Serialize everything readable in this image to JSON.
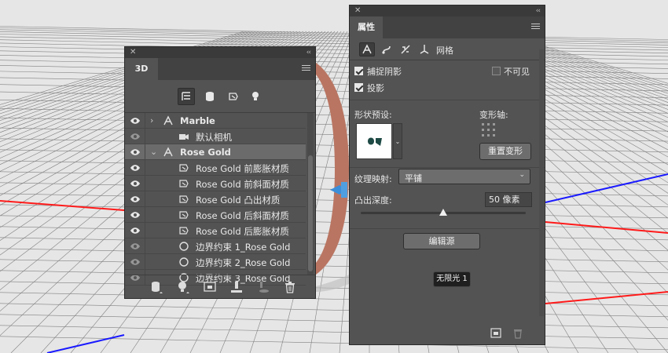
{
  "panel_3d": {
    "tab": "3D",
    "toolbar": [
      "scene-filter-icon",
      "mesh-filter-icon",
      "material-filter-icon",
      "light-filter-icon"
    ],
    "layers": [
      {
        "label": "Marble",
        "visible": true,
        "icon": "mesh-icon",
        "expandable": true,
        "expanded": false,
        "bold": true
      },
      {
        "label": "默认相机",
        "visible": false,
        "icon": "camera-icon"
      },
      {
        "label": "Rose Gold",
        "visible": true,
        "icon": "mesh-icon",
        "expandable": true,
        "expanded": true,
        "bold": true,
        "selected": true
      },
      {
        "label": "Rose Gold 前膨胀材质",
        "visible": true,
        "icon": "material-icon"
      },
      {
        "label": "Rose Gold 前斜面材质",
        "visible": true,
        "icon": "material-icon"
      },
      {
        "label": "Rose Gold 凸出材质",
        "visible": true,
        "icon": "material-icon"
      },
      {
        "label": "Rose Gold 后斜面材质",
        "visible": true,
        "icon": "material-icon"
      },
      {
        "label": "Rose Gold 后膨胀材质",
        "visible": true,
        "icon": "material-icon"
      },
      {
        "label": "边界约束 1_Rose Gold",
        "visible": false,
        "icon": "constraint-icon"
      },
      {
        "label": "边界约束 2_Rose Gold",
        "visible": false,
        "icon": "constraint-icon"
      },
      {
        "label": "边界约束 3_Rose Gold",
        "visible": false,
        "icon": "constraint-icon"
      }
    ],
    "footer": [
      "add-mesh-icon",
      "add-light-icon",
      "render-icon",
      "ground-icon",
      "ground-shadow-icon",
      "trash-icon"
    ]
  },
  "panel_props": {
    "tab": "属性",
    "mode_tabs": [
      "mesh-mode-icon",
      "deform-mode-icon",
      "cap-mode-icon",
      "coordinates-mode-icon"
    ],
    "mode_label": "网格",
    "catch_shadows": {
      "label": "捕捉阴影",
      "checked": true
    },
    "invisible": {
      "label": "不可见",
      "checked": false
    },
    "cast_shadows": {
      "label": "投影",
      "checked": true
    },
    "shape_preset_label": "形状预设:",
    "deform_axis_label": "变形轴:",
    "reset_deform_button": "重置变形",
    "texture_mapping_label": "纹理映射:",
    "texture_mapping_value": "平铺",
    "extrusion_depth_label": "凸出深度:",
    "extrusion_depth_value": "50 像素",
    "edit_source_button": "编辑源",
    "tooltip": "无限光 1",
    "footer": [
      "render-settings-icon",
      "trash-icon"
    ]
  },
  "colors": {
    "panel_bg": "#535353",
    "ring": "#b97562",
    "axis_red": "#ff1a1a",
    "axis_blue": "#1a1aff",
    "gizmo": "#3c8ed8"
  }
}
